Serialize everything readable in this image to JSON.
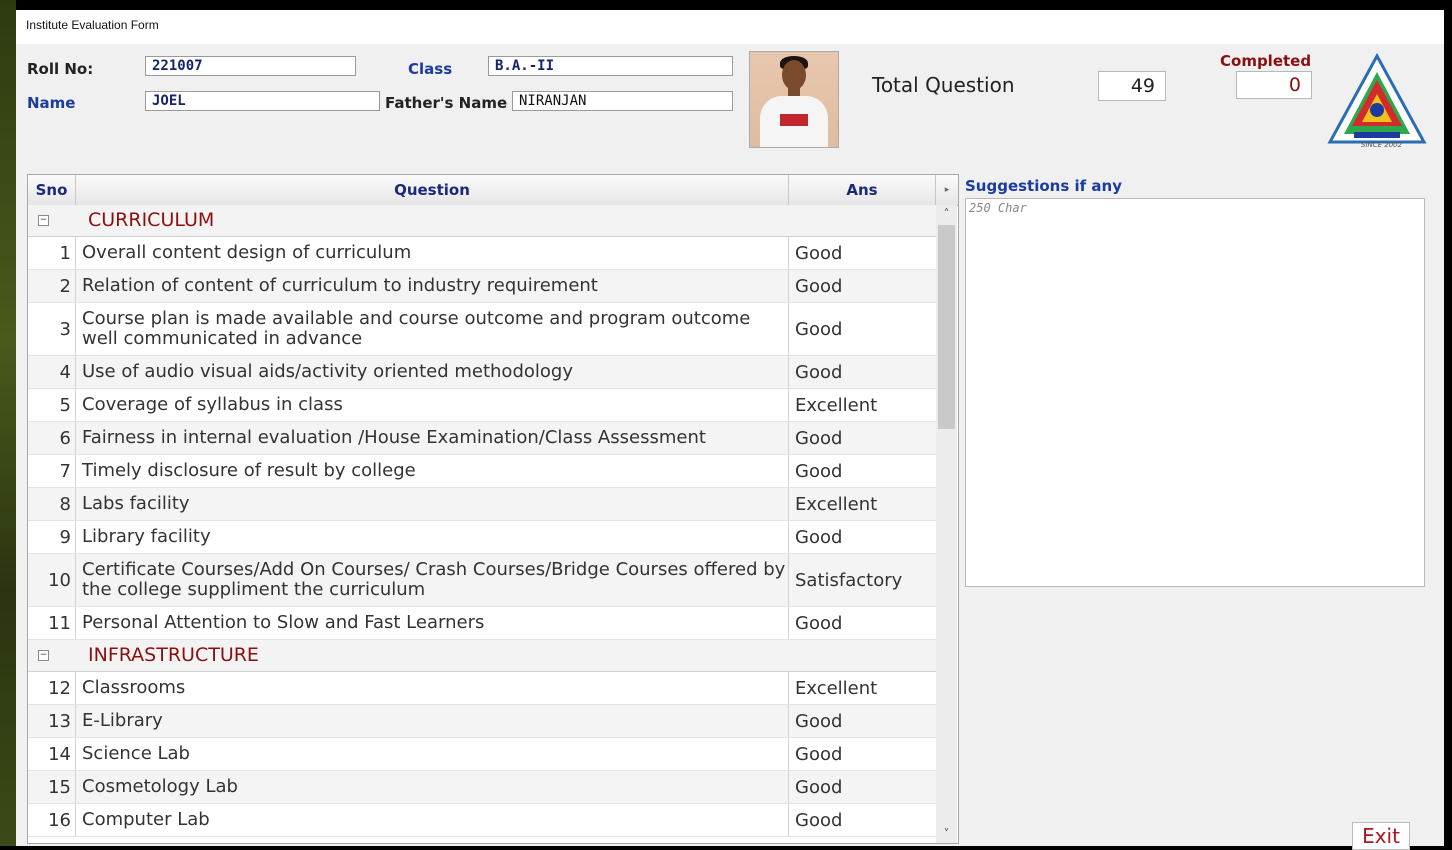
{
  "window": {
    "title": "Institute Evaluation Form"
  },
  "student": {
    "roll_label": "Roll No:",
    "roll_value": "221007",
    "class_label": "Class",
    "class_value": "B.A.-II",
    "name_label": "Name",
    "name_value": "JOEL",
    "father_label": "Father's Name",
    "father_value": "NIRANJAN"
  },
  "stats": {
    "total_label": "Total Question",
    "total_value": "49",
    "completed_label": "Completed",
    "completed_value": "0"
  },
  "emblem": {
    "tagline": "SINCE 2002"
  },
  "grid": {
    "headers": {
      "sno": "Sno",
      "question": "Question",
      "ans": "Ans"
    },
    "groups": [
      {
        "title": "CURRICULUM",
        "rows": [
          {
            "sno": "1",
            "q": "Overall content design of curriculum",
            "a": "Good"
          },
          {
            "sno": "2",
            "q": "Relation of content of curriculum to industry requirement",
            "a": "Good"
          },
          {
            "sno": "3",
            "q": "Course plan is made available and course outcome and program outcome well communicated in advance",
            "a": "Good"
          },
          {
            "sno": "4",
            "q": "Use of audio visual aids/activity oriented methodology",
            "a": "Good"
          },
          {
            "sno": "5",
            "q": "Coverage of syllabus in class",
            "a": "Excellent"
          },
          {
            "sno": "6",
            "q": "Fairness in internal evaluation /House Examination/Class Assessment",
            "a": "Good"
          },
          {
            "sno": "7",
            "q": "Timely disclosure of result by college",
            "a": "Good"
          },
          {
            "sno": "8",
            "q": "Labs facility",
            "a": "Excellent"
          },
          {
            "sno": "9",
            "q": "Library facility",
            "a": "Good"
          },
          {
            "sno": "10",
            "q": "Certificate Courses/Add On Courses/ Crash Courses/Bridge Courses offered by the college suppliment the curriculum",
            "a": "Satisfactory"
          },
          {
            "sno": "11",
            "q": "Personal Attention to Slow and Fast Learners",
            "a": "Good"
          }
        ]
      },
      {
        "title": "INFRASTRUCTURE",
        "rows": [
          {
            "sno": "12",
            "q": "Classrooms",
            "a": "Excellent"
          },
          {
            "sno": "13",
            "q": "E-Library",
            "a": "Good"
          },
          {
            "sno": "14",
            "q": "Science Lab",
            "a": "Good"
          },
          {
            "sno": "15",
            "q": "Cosmetology Lab",
            "a": "Good"
          },
          {
            "sno": "16",
            "q": "Computer Lab",
            "a": "Good"
          }
        ]
      }
    ]
  },
  "suggestions": {
    "label": "Suggestions if any",
    "placeholder": "250 Char"
  },
  "buttons": {
    "exit": "Exit"
  },
  "icons": {
    "collapse": "minus-box-icon",
    "scroll_up": "chevron-up-icon",
    "scroll_down": "chevron-down-icon",
    "scroll_right": "chevron-right-icon"
  }
}
